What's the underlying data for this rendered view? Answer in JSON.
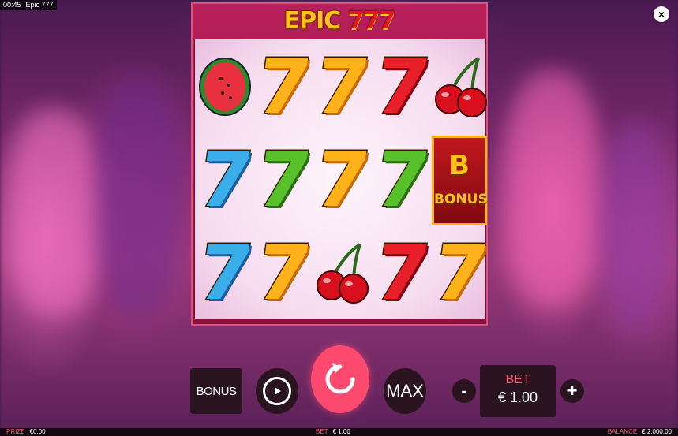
{
  "topbar": {
    "time": "00:45",
    "game_name": "Epic 777"
  },
  "close_label": "×",
  "logo": {
    "word": "EPIC",
    "number": "777"
  },
  "reels": [
    [
      "watermelon",
      "seven-gold",
      "seven-gold",
      "seven-red",
      "cherry"
    ],
    [
      "seven-blue",
      "seven-green",
      "seven-gold",
      "seven-green",
      "bonus"
    ],
    [
      "seven-blue",
      "seven-gold",
      "cherry",
      "seven-red",
      "seven-gold"
    ]
  ],
  "bonus_tile": {
    "letter": "B",
    "text": "BONUS"
  },
  "controls": {
    "bonus_label": "BONUS",
    "max_label": "MAX",
    "minus_label": "-",
    "plus_label": "+",
    "bet_label": "BET",
    "bet_value": "€ 1.00"
  },
  "statusbar": {
    "prize_label": "PRIZE",
    "prize_value": "€0.00",
    "bet_label": "BET",
    "bet_value": "€ 1.00",
    "balance_label": "BALANCE",
    "balance_value": "€ 2,000.00"
  },
  "colors": {
    "spin": "#ff4a70",
    "accent": "#ff5a7a",
    "frame": "#b8205a"
  }
}
